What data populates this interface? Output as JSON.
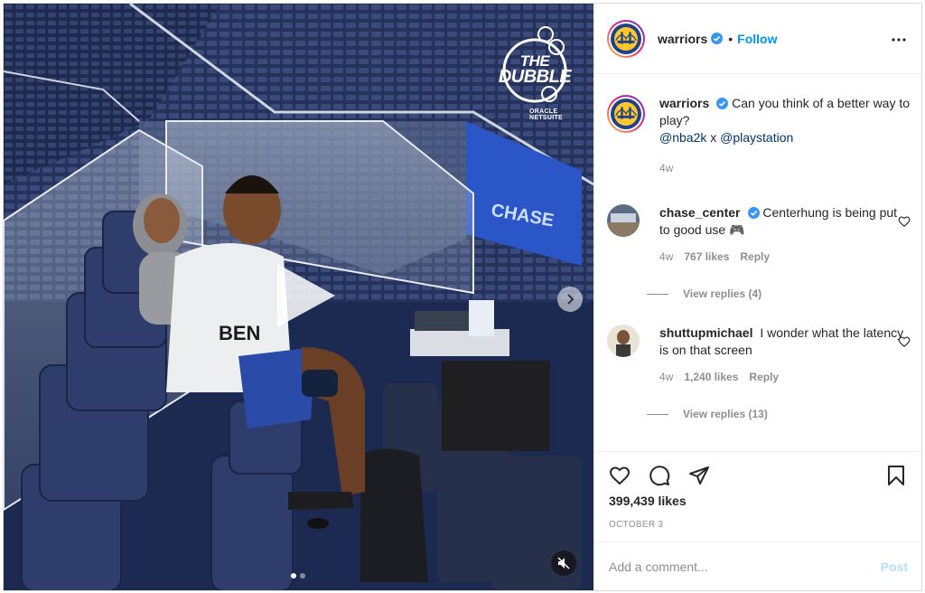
{
  "post": {
    "author": "warriors",
    "verified": true,
    "follow_label": "Follow",
    "separator": "•",
    "caption_text": "Can you think of a better way to play?",
    "caption_mentions": [
      "@nba2k",
      "@playstation"
    ],
    "caption_mention_joiner": "x",
    "caption_age": "4w",
    "likes": "399,439 likes",
    "date": "OCTOBER 3"
  },
  "media": {
    "overlay_logo": {
      "line1": "THE",
      "line2": "DUBBLE",
      "sponsor": "ORACLE NETSUITE"
    },
    "arena_sign": "CHASE",
    "jersey_text": "BEN",
    "carousel_pages": 2,
    "carousel_active": 1
  },
  "comments": [
    {
      "username": "chase_center",
      "verified": true,
      "text": "Centerhung is being put to good use 🎮",
      "age": "4w",
      "likes": "767 likes",
      "reply_label": "Reply",
      "view_replies": "View replies (4)"
    },
    {
      "username": "shuttupmichael",
      "verified": false,
      "text": "I wonder what the latency is on that screen",
      "age": "4w",
      "likes": "1,240 likes",
      "reply_label": "Reply",
      "view_replies": "View replies (13)"
    }
  ],
  "composer": {
    "placeholder": "Add a comment...",
    "post_label": "Post"
  },
  "colors": {
    "link": "#0095f6",
    "mention": "#00376b",
    "post_disabled": "#b2dffc",
    "verified": "#3897f0"
  },
  "icons": [
    "more-options-icon",
    "heart-icon",
    "comment-icon",
    "share-icon",
    "bookmark-icon",
    "play-icon",
    "next-arrow-icon",
    "muted-icon",
    "verified-badge-icon"
  ]
}
